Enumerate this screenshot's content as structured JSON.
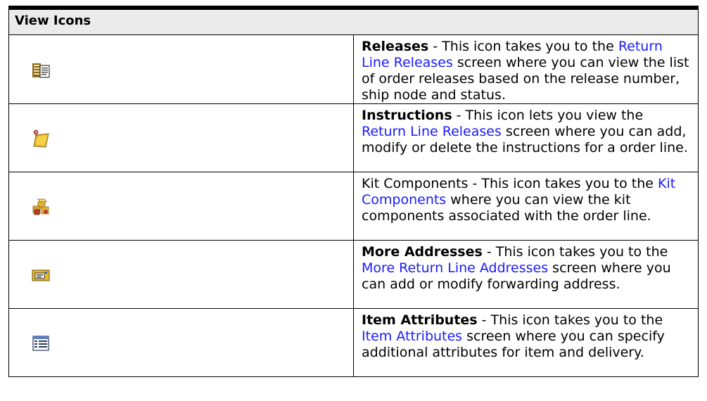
{
  "table": {
    "header": "View Icons",
    "rows": [
      {
        "icon": "releases-icon",
        "bold": "Releases",
        "pre": " - This icon takes you to the ",
        "link": "Return Line Releases",
        "post": " screen where you can view the list of order releases based on the release number, ship node and status."
      },
      {
        "icon": "instructions-icon",
        "bold": "Instructions",
        "pre": " - This icon lets you view the ",
        "link": "Return Line Releases",
        "post": " screen where you can add, modify or delete the instructions for a order line."
      },
      {
        "icon": "kit-components-icon",
        "bold": "",
        "pre": "Kit Components - This icon takes you to the ",
        "link": "Kit Components",
        "post": " where you can view the kit components associated with the order line."
      },
      {
        "icon": "more-addresses-icon",
        "bold": "More Addresses",
        "pre": " - This icon takes you to the ",
        "link": "More Return Line Addresses",
        "post": " screen where you can add or modify forwarding address."
      },
      {
        "icon": "item-attributes-icon",
        "bold": "Item Attributes",
        "pre": " - This icon takes you to the ",
        "link": "Item Attributes",
        "post": " screen where you can specify additional attributes for item and delivery."
      }
    ]
  }
}
